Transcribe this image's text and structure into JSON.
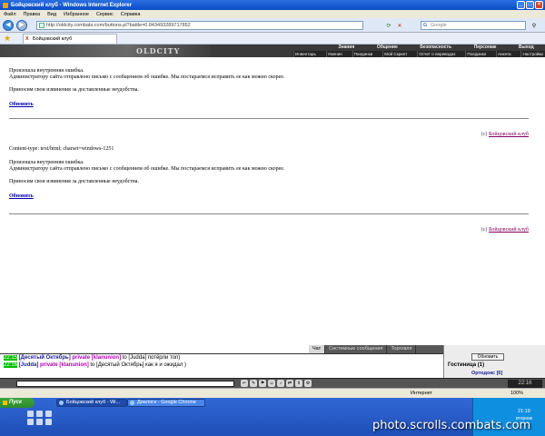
{
  "window": {
    "title": "Бойцовский клуб - Windows Internet Explorer",
    "minimize": "_",
    "maximize": "□",
    "close": "×"
  },
  "menubar": [
    "Файл",
    "Правка",
    "Вид",
    "Избранное",
    "Сервис",
    "Справка"
  ],
  "addressbar": {
    "url": "http://oldcity.combats.com/buttons.pl?battle=0.843493289717852",
    "search_placeholder": "Google"
  },
  "tab": {
    "label": "Бойцовский клуб"
  },
  "game_header": {
    "logo": "OLDCITY",
    "nav_top": [
      "Знания",
      "Общение",
      "Безопасность",
      "Персонаж",
      "Выход"
    ],
    "nav_bottom": [
      "Инвентарь",
      "Умения",
      "Поединки",
      "Мой Скрипт",
      "Отчет о переводах",
      "Поединки",
      "Анкета",
      "Настройки"
    ]
  },
  "errors": [
    {
      "content_type": "",
      "line1": "Произошла внутренняя ошибка.",
      "line2": "Администратору сайта отправлено письмо с сообщением об ошибке. Мы постараемся исправить ее как можно скорее.",
      "line3": "Приносим свои извинения за доставленные неудобства.",
      "refresh": "Обновить",
      "copy_prefix": "(c)",
      "copy_link": "Бойцовский клуб"
    },
    {
      "content_type": "Content-type: text/html; charset=windows-1251",
      "line1": "Произошла внутренняя ошибка.",
      "line2": "Администратору сайта отправлено письмо с сообщением об ошибке. Мы постараемся исправить ее как можно скорее.",
      "line3": "Приносим свои извинения за доставленные неудобства.",
      "refresh": "Обновить",
      "copy_prefix": "(c)",
      "copy_link": "Бойцовский клуб"
    }
  ],
  "chat": {
    "tabs": [
      "Чат",
      "Системные сообщения",
      "Торговля"
    ],
    "messages": [
      {
        "time": "22:15",
        "from": "[Десятый Октябрь]",
        "private": "private [klanunion]",
        "rest": "to [Judda] потёрли топ)"
      },
      {
        "time": "22:16",
        "from": "[Judda]",
        "private": "private [klanunion]",
        "rest": "to [Десятый Октябрь] как я и ожидал )"
      }
    ],
    "refresh_button": "Обновить",
    "location": "Гостиница (1)",
    "user": "Ортодокс [6]",
    "clock": "22:16"
  },
  "statusbar": {
    "zone": "Интернет",
    "zoom": "100%"
  },
  "taskbar": {
    "start": "Пуск",
    "tasks": [
      "Бойцовский клуб - Wi...",
      "Диалоги - Google Chrome"
    ],
    "time": "21:19",
    "day": "вторник"
  },
  "watermark": "photo.scrolls.combats.com"
}
